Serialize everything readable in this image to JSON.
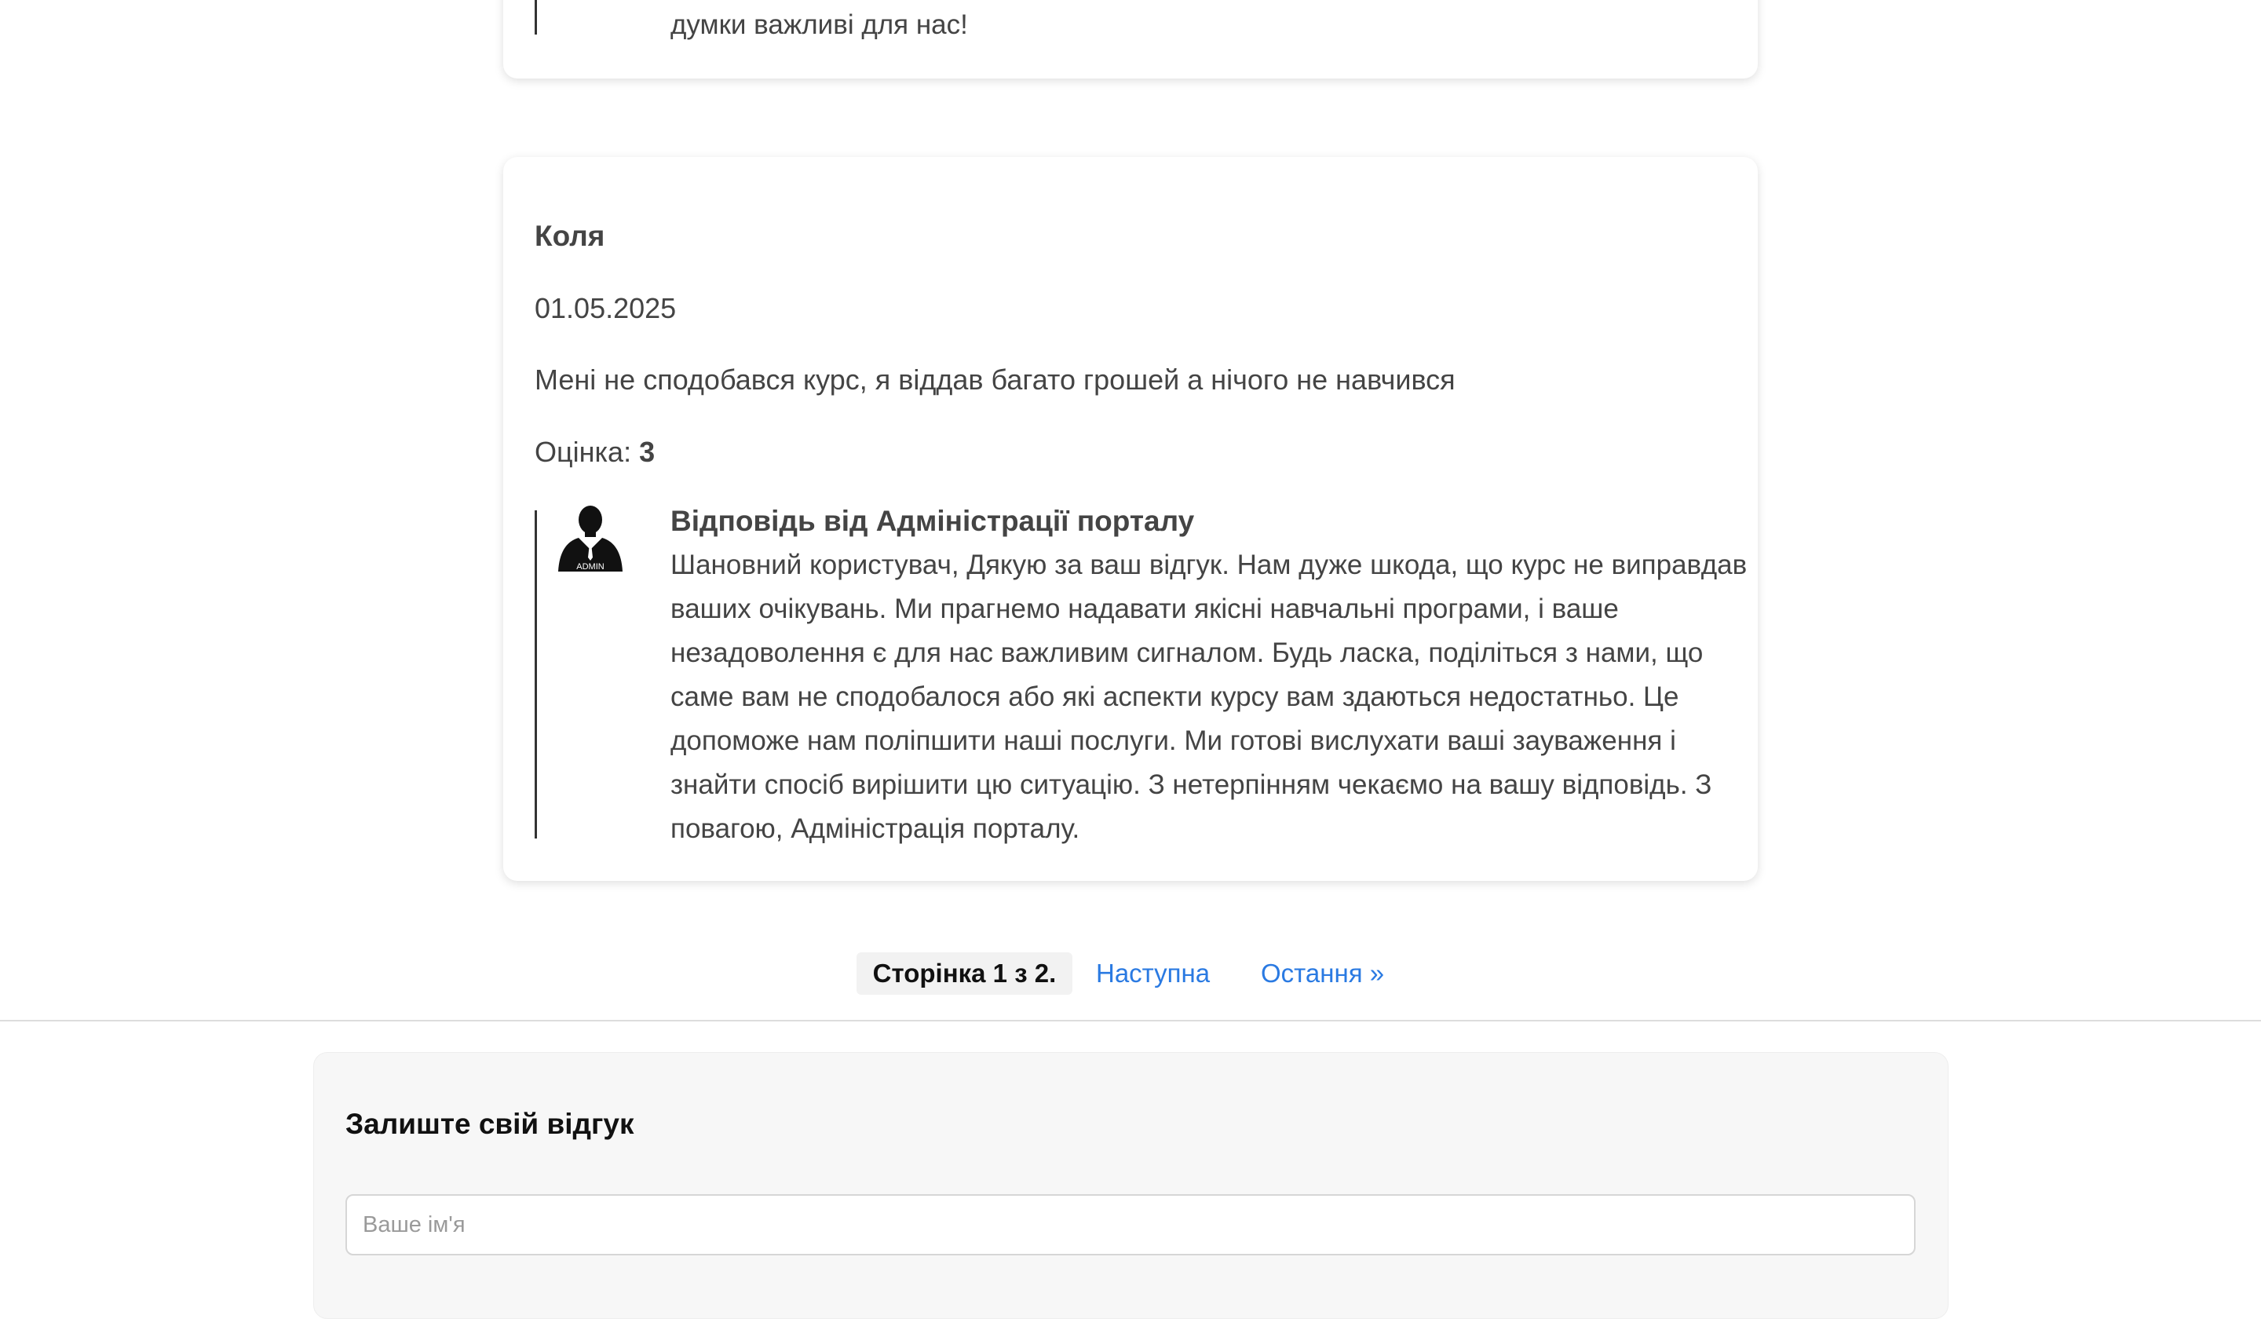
{
  "prev_review": {
    "reply_text_tail": "думки важливі для нас!"
  },
  "review": {
    "author": "Коля",
    "date": "01.05.2025",
    "text": "Мені не сподобався курс, я віддав багато грошей а нічого не навчився",
    "rating_label": "Оцінка: ",
    "rating_value": "3",
    "reply": {
      "avatar_badge": "ADMIN",
      "title": "Відповідь від Адміністрації порталу",
      "text": "Шановний користувач, Дякую за ваш відгук. Нам дуже шкода, що курс не виправдав ваших очікувань. Ми прагнемо надавати якісні навчальні програми, і ваше незадоволення є для нас важливим сигналом. Будь ласка, поділіться з нами, що саме вам не сподобалося або які аспекти курсу вам здаються недостатньо. Це допоможе нам поліпшити наші послуги. Ми готові вислухати ваші зауваження і знайти спосіб вирішити цю ситуацію. З нетерпінням чекаємо на вашу відповідь. З повагою, Адміністрація порталу."
    }
  },
  "pagination": {
    "current": "Сторінка 1 з 2.",
    "next": "Наступна",
    "last": "Остання »"
  },
  "form": {
    "title": "Залиште свій відгук",
    "name_placeholder": "Ваше ім'я"
  },
  "colors": {
    "link": "#2a7ae2",
    "text": "#444444"
  }
}
